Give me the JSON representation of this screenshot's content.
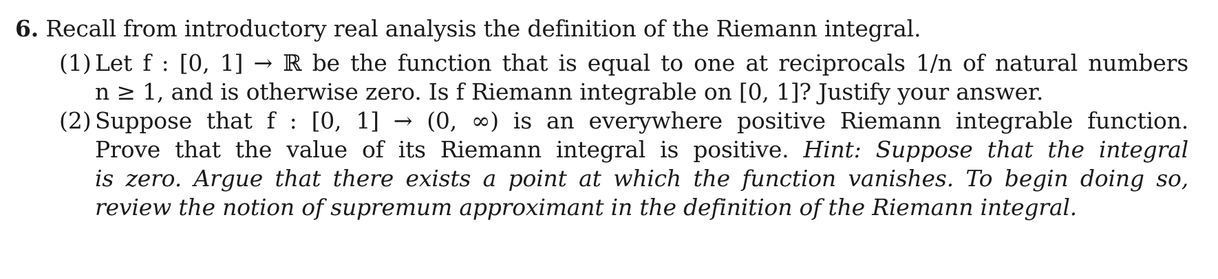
{
  "problem": {
    "number": "6.",
    "intro": "Recall from introductory real analysis the definition of the Riemann integral.",
    "parts": [
      {
        "label": "(1)",
        "lines": [
          "Let f : [0, 1] → ℝ be the function that is equal to one at reciprocals 1/n of natural numbers",
          "n ≥ 1, and is otherwise zero. Is f Riemann integrable on [0, 1]? Justify your answer."
        ]
      },
      {
        "label": "(2)",
        "lines": [
          "Suppose that f : [0, 1] → (0, ∞) is an everywhere positive Riemann integrable function.",
          "Prove that the value of its Riemann integral is positive."
        ],
        "hint_lines": [
          "Hint: Suppose that the integral",
          "is zero. Argue that there exists a point at which the function vanishes. To begin doing so,",
          "review the notion of supremum approximant in the definition of the Riemann integral."
        ]
      }
    ]
  }
}
